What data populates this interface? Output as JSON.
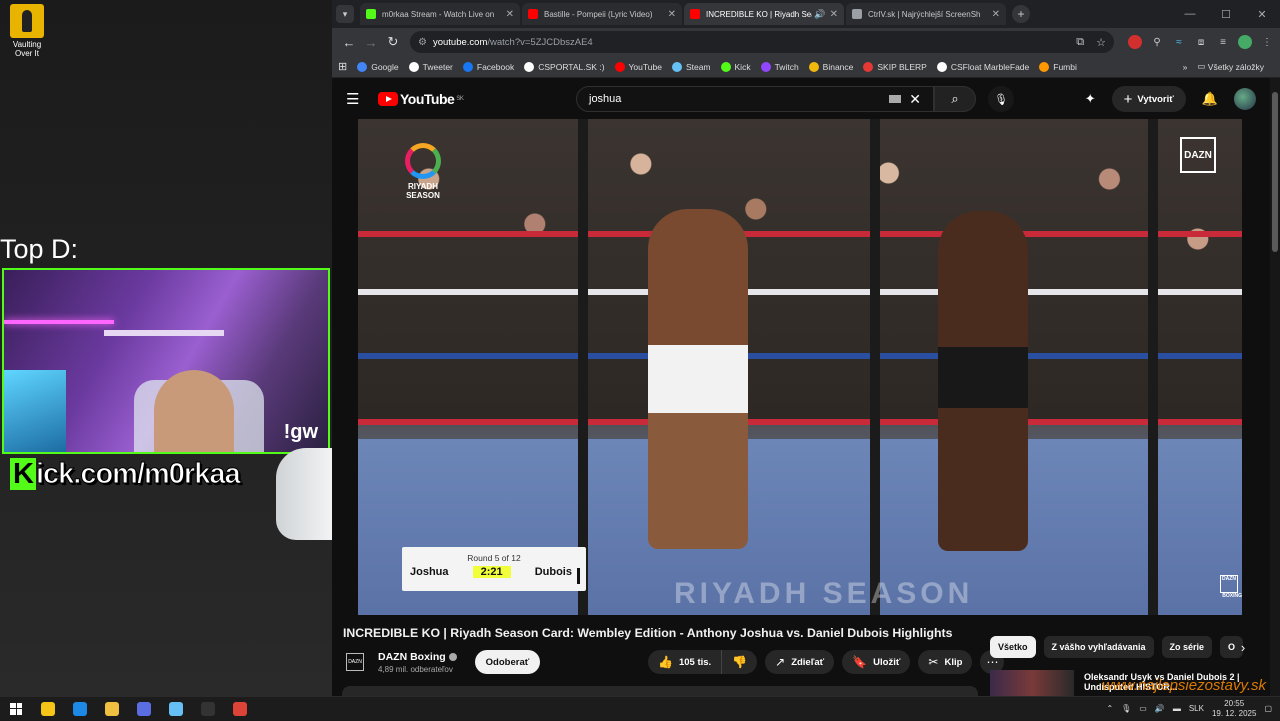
{
  "desktop": {
    "icon_label": "Vaulting Over It",
    "top_label": "Top D:",
    "webcam_tag": "!gw",
    "kick_prefix": "K",
    "kick_rest": "ick.com/m0rkaa"
  },
  "browser": {
    "tabs": [
      {
        "title": "m0rkaa Stream - Watch Live on",
        "color": "#53fc18",
        "active": false,
        "audio": false
      },
      {
        "title": "Bastille - Pompeii (Lyric Video)",
        "color": "#ff0000",
        "active": false,
        "audio": false
      },
      {
        "title": "INCREDIBLE KO | Riyadh Sea",
        "color": "#ff0000",
        "active": true,
        "audio": true
      },
      {
        "title": "CtrlV.sk | Najrýchlejší ScreenSh",
        "color": "#9aa0a6",
        "active": false,
        "audio": false
      }
    ],
    "url_host": "youtube.com",
    "url_path": "/watch?v=5ZJCDbszAE4",
    "bookmarks": [
      {
        "label": "Google",
        "color": "#4285f4"
      },
      {
        "label": "Tweeter",
        "color": "#ffffff"
      },
      {
        "label": "Facebook",
        "color": "#1877f2"
      },
      {
        "label": "CSPORTAL.SK :)",
        "color": "#ffffff"
      },
      {
        "label": "YouTube",
        "color": "#ff0000"
      },
      {
        "label": "Steam",
        "color": "#66c0f4"
      },
      {
        "label": "Kick",
        "color": "#53fc18"
      },
      {
        "label": "Twitch",
        "color": "#9146ff"
      },
      {
        "label": "Binance",
        "color": "#f0b90b"
      },
      {
        "label": "SKIP BLERP",
        "color": "#e53935"
      },
      {
        "label": "CSFloat MarbleFade",
        "color": "#ffffff"
      },
      {
        "label": "Fumbi",
        "color": "#ff9800"
      }
    ],
    "bookmarks_all": "Všetky záložky"
  },
  "youtube": {
    "logo": "YouTube",
    "region": "SK",
    "search_value": "joshua",
    "create_label": "Vytvoriť",
    "player": {
      "riyadh_text": "RIYADH SEASON",
      "dazn": "DAZN",
      "dazn_small": "DAZN",
      "dazn_boxing": "BOXING",
      "floor_text": "RIYADH SEASON",
      "scorebug": {
        "round": "Round 5 of 12",
        "fighter_a": "Joshua",
        "clock": "2:21",
        "fighter_b": "Dubois"
      }
    },
    "video_title": "INCREDIBLE KO | Riyadh Season Card: Wembley Edition - Anthony Joshua vs. Daniel Dubois Highlights",
    "channel": {
      "name": "DAZN Boxing",
      "subscribers": "4,89 mil. odberateľov",
      "subscribe_label": "Odoberať"
    },
    "actions": {
      "likes": "105 tis.",
      "share": "Zdieľať",
      "save": "Uložiť",
      "clip": "Klip"
    },
    "chips": [
      "Všetko",
      "Z vášho vyhľadávania",
      "Zo série",
      "O"
    ],
    "recommendation": {
      "title": "Oleksandr Usyk vs Daniel Dubois 2 | Undisputed HISTOR..."
    },
    "watermark": "www.najlepsiezostavy.sk"
  },
  "taskbar": {
    "lang": "SLK",
    "time": "20:55",
    "date": "19. 12. 2025",
    "apps": [
      {
        "name": "explorer",
        "color": "#f5c518"
      },
      {
        "name": "files",
        "color": "#1e88e5"
      },
      {
        "name": "folder",
        "color": "#f0c040"
      },
      {
        "name": "chrome-alt",
        "color": "#5b6ee1"
      },
      {
        "name": "steam",
        "color": "#66c0f4"
      },
      {
        "name": "obs",
        "color": "#333333"
      },
      {
        "name": "chrome",
        "color": "#db4437"
      }
    ]
  }
}
